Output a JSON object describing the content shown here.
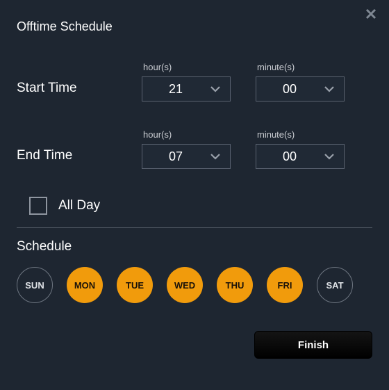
{
  "title": "Offtime Schedule",
  "start": {
    "label": "Start Time",
    "hour_caption": "hour(s)",
    "hour_value": "21",
    "minute_caption": "minute(s)",
    "minute_value": "00"
  },
  "end": {
    "label": "End Time",
    "hour_caption": "hour(s)",
    "hour_value": "07",
    "minute_caption": "minute(s)",
    "minute_value": "00"
  },
  "all_day": {
    "label": "All Day",
    "checked": false
  },
  "schedule": {
    "heading": "Schedule",
    "days": [
      {
        "abbr": "SUN",
        "selected": false
      },
      {
        "abbr": "MON",
        "selected": true
      },
      {
        "abbr": "TUE",
        "selected": true
      },
      {
        "abbr": "WED",
        "selected": true
      },
      {
        "abbr": "THU",
        "selected": true
      },
      {
        "abbr": "FRI",
        "selected": true
      },
      {
        "abbr": "SAT",
        "selected": false
      }
    ]
  },
  "finish_label": "Finish",
  "colors": {
    "accent": "#f19b0c",
    "bg": "#1e2631"
  }
}
